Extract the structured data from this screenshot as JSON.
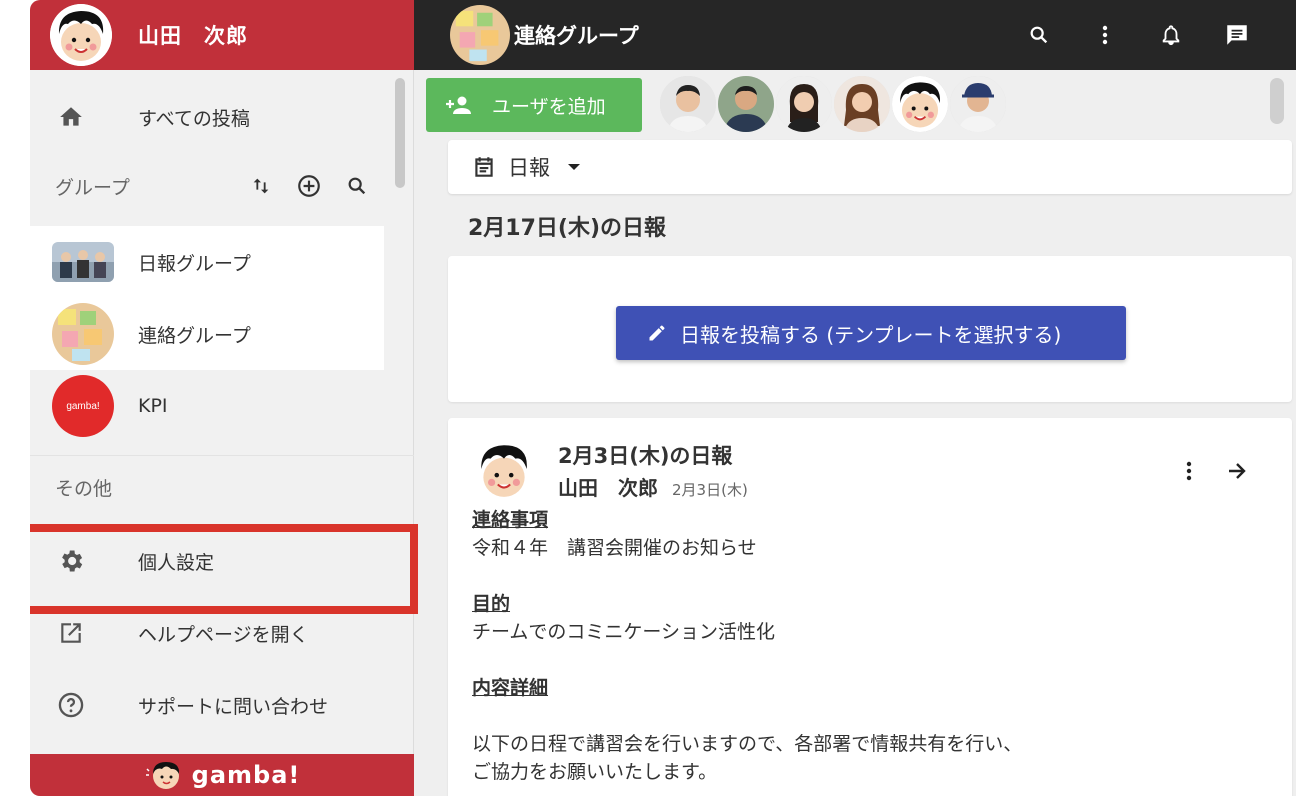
{
  "sidebar": {
    "user_name": "山田　次郎",
    "nav_all_posts": "すべての投稿",
    "groups_label": "グループ",
    "groups": [
      {
        "label": "日報グループ"
      },
      {
        "label": "連絡グループ"
      },
      {
        "label": "KPI",
        "thumb_text": "gamba!"
      }
    ],
    "other_label": "その他",
    "other_items": [
      {
        "label": "個人設定"
      },
      {
        "label": "ヘルプページを開く"
      },
      {
        "label": "サポートに問い合わせ"
      }
    ],
    "footer_brand": "gamba!"
  },
  "topbar": {
    "group_title": "連絡グループ"
  },
  "main": {
    "add_user_label": "ユーザを追加",
    "type_select_value": "日報",
    "report_date_title": "2月17日(木)の日報",
    "post_button_label": "日報を投稿する (テンプレートを選択する)",
    "report": {
      "title": "2月3日(木)の日報",
      "author": "山田　次郎",
      "date": "2月3日(木)",
      "sections": [
        {
          "heading": "連絡事項",
          "text": "令和４年　講習会開催のお知らせ"
        },
        {
          "heading": "目的",
          "text": "チームでのコミニケーション活性化"
        },
        {
          "heading": "内容詳細",
          "text": ""
        }
      ],
      "detail_line1": "以下の日程で講習会を行いますので、各部署で情報共有を行い、",
      "detail_line2": "ご協力をお願いいたします。"
    }
  },
  "colors": {
    "brand_red": "#c1303a",
    "topbar": "#262626",
    "add_user_green": "#5cb85c",
    "post_button_blue": "#3f51b5",
    "highlight": "#d9342b"
  }
}
